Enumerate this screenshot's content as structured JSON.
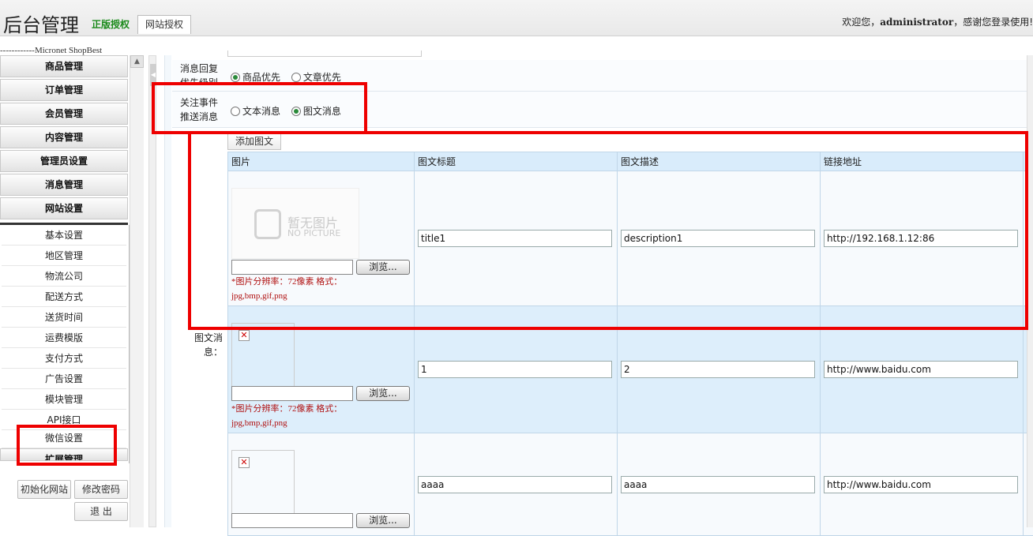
{
  "header": {
    "title": "后台管理",
    "license_text": "正版授权",
    "license_button": "网站授权",
    "welcome_prefix": "欢迎您，",
    "username": "administrator",
    "welcome_suffix": "，感谢您登录使用!"
  },
  "sidebar": {
    "brand_line": "------------Micronet ShopBest",
    "menus": [
      "商品管理",
      "订单管理",
      "会员管理",
      "内容管理",
      "管理员设置",
      "消息管理",
      "网站设置"
    ],
    "submenu": [
      "基本设置",
      "地区管理",
      "物流公司",
      "配送方式",
      "送货时间",
      "运费模版",
      "支付方式",
      "广告设置",
      "模块管理",
      "API接口",
      "微信设置"
    ],
    "cut_menu": "扩展管理",
    "buttons": {
      "init": "初始化网站",
      "change_password": "修改密码",
      "logout": "退 出"
    }
  },
  "form": {
    "priority": {
      "label_line1": "消息回复",
      "label_line2": "优先级别",
      "options": [
        {
          "label": "商品优先",
          "checked": true
        },
        {
          "label": "文章优先",
          "checked": false
        }
      ]
    },
    "push": {
      "label_line1": "关注事件",
      "label_line2": "推送消息",
      "options": [
        {
          "label": "文本消息",
          "checked": false
        },
        {
          "label": "图文消息",
          "checked": true
        }
      ]
    },
    "picmsg": {
      "label_line1": "图文消",
      "label_line2": "息：",
      "add_button": "添加图文",
      "columns": [
        "图片",
        "图文标题",
        "图文描述",
        "链接地址"
      ],
      "browse_label": "浏览...",
      "hint_line1": "*图片分辨率：72像素 格式：",
      "hint_line2": "jpg,bmp,gif,png",
      "no_picture_cn": "暂无图片",
      "no_picture_en": "NO PICTURE",
      "rows": [
        {
          "title": "title1",
          "desc": "description1",
          "link": "http://192.168.1.12:86"
        },
        {
          "title": "1",
          "desc": "2",
          "link": "http://www.baidu.com"
        },
        {
          "title": "aaaa",
          "desc": "aaaa",
          "link": "http://www.baidu.com"
        }
      ]
    }
  },
  "colors": {
    "highlight": "#e00000",
    "license_green": "#1a8a1a",
    "hint_red": "#b01010",
    "table_header": "#d9ecfb"
  }
}
